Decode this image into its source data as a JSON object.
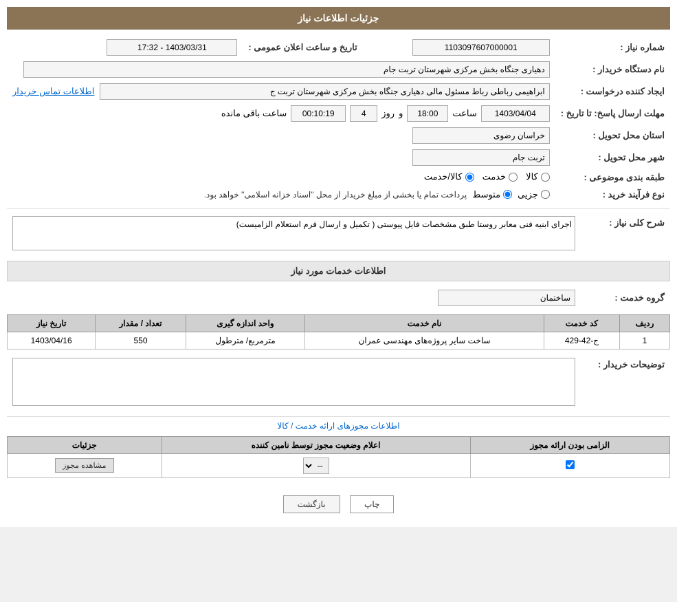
{
  "page": {
    "title": "جزئیات اطلاعات نیاز",
    "sections": {
      "header": "جزئیات اطلاعات نیاز",
      "service_info": "اطلاعات خدمات مورد نیاز",
      "license_info": "اطلاعات مجوزهای ارائه خدمت / کالا"
    }
  },
  "fields": {
    "shomara_niaz_label": "شماره نیاز :",
    "shomara_niaz_value": "1103097607000001",
    "name_dastgah_label": "نام دستگاه خریدار :",
    "name_dastgah_value": "دهیاری جنگاه بخش مرکزی شهرستان تربت جام",
    "ijad_konande_label": "ایجاد کننده درخواست :",
    "ijad_konande_value": "ابراهیمی رباطی رباط مسئول مالی دهیاری جنگاه بخش مرکزی شهرستان تربت ج",
    "ejad_konande_link": "اطلاعات تماس خریدار",
    "tarikh_label": "تاریخ و ساعت اعلان عمومی :",
    "tarikh_value": "1403/03/31 - 17:32",
    "mohlat_label": "مهلت ارسال پاسخ: تا تاریخ :",
    "mohlat_date": "1403/04/04",
    "mohlat_time": "18:00",
    "mohlat_roz": "4",
    "mohlat_saat": "00:10:19",
    "mohlat_baghimande": "ساعت باقی مانده",
    "ostan_label": "استان محل تحویل :",
    "ostan_value": "خراسان رضوی",
    "shahr_label": "شهر محل تحویل :",
    "shahr_value": "تربت جام",
    "tabaghe_label": "طبقه بندی موضوعی :",
    "radio_kala": "کالا",
    "radio_khedmat": "خدمت",
    "radio_kala_khedmat": "کالا/خدمت",
    "now_farayand_label": "نوع فرآیند خرید :",
    "radio_jozee": "جزیی",
    "radio_motavsat": "متوسط",
    "farayand_desc": "پرداخت تمام یا بخشی از مبلغ خریدار از محل \"اسناد خزانه اسلامی\" خواهد بود.",
    "sharh_label": "شرح کلی نیاز :",
    "sharh_value": "اجرای ابنیه فنی معابر روستا طبق مشخصات فایل پیوستی ( تکمیل و ارسال فرم استعلام الزامیست)",
    "service_group_label": "گروه خدمت :",
    "service_group_value": "ساختمان"
  },
  "service_table": {
    "headers": [
      "ردیف",
      "کد خدمت",
      "نام خدمت",
      "واحد اندازه گیری",
      "تعداد / مقدار",
      "تاریخ نیاز"
    ],
    "rows": [
      {
        "radif": "1",
        "kod": "ج-42-429",
        "name": "ساخت سایر پروژه‌های مهندسی عمران",
        "vahed": "مترمربع/ مترطول",
        "tedad": "550",
        "tarikh": "1403/04/16"
      }
    ]
  },
  "description_label": "توضیحات خریدار :",
  "description_value": "",
  "license_table": {
    "subtitle": "اطلاعات مجوزهای ارائه خدمت / کالا",
    "headers": [
      "الزامی بودن ارائه مجوز",
      "اعلام وضعیت مجوز توسط نامین کننده",
      "جزئیات"
    ],
    "rows": [
      {
        "elzami": "checked",
        "alam_vaziat": "--",
        "joziat": "مشاهده مجوز"
      }
    ]
  },
  "buttons": {
    "print": "چاپ",
    "back": "بازگشت"
  }
}
